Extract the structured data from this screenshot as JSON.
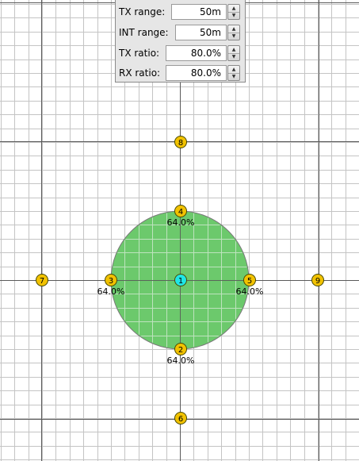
{
  "controls": {
    "tx_range": {
      "label": "TX range:",
      "value": "50m"
    },
    "int_range": {
      "label": "INT range:",
      "value": "50m"
    },
    "tx_ratio": {
      "label": "TX ratio:",
      "value": "80.0%"
    },
    "rx_ratio": {
      "label": "RX ratio:",
      "value": "80.0%"
    },
    "spin_up_icon": "triangle-up",
    "spin_down_icon": "triangle-down"
  },
  "nodes": [
    {
      "id": "1",
      "label": "",
      "selected": true
    },
    {
      "id": "2",
      "label": "64.0%"
    },
    {
      "id": "3",
      "label": "64.0%"
    },
    {
      "id": "4",
      "label": "64.0%"
    },
    {
      "id": "5",
      "label": "64.0%"
    },
    {
      "id": "6",
      "label": ""
    },
    {
      "id": "7",
      "label": ""
    },
    {
      "id": "8",
      "label": ""
    },
    {
      "id": "9",
      "label": ""
    }
  ],
  "colors": {
    "grid_minor": "#c4c4c4",
    "grid_major": "#5a5a5a",
    "range_fill": "#6cc96c",
    "range_stroke": "#7a7a7a",
    "node_fill": "#f2c200",
    "node_selected_fill": "#1fe6e6",
    "node_stroke": "#4a4a00"
  }
}
